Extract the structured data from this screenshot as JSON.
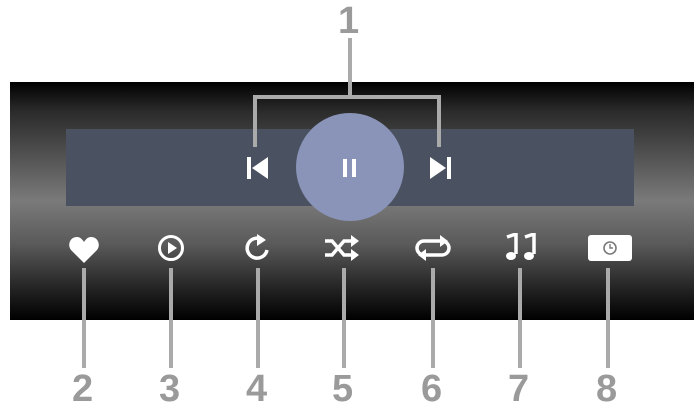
{
  "callouts": [
    "1",
    "2",
    "3",
    "4",
    "5",
    "6",
    "7",
    "8"
  ],
  "colors": {
    "panel_dark": "#000000",
    "panel_mid": "#7a7a7a",
    "transport_bar": "#4a5160",
    "play_circle": "#8a94b8",
    "icon": "#ffffff",
    "callout": "#9a9a9a"
  },
  "controls": {
    "transport": [
      "previous-icon",
      "pause-icon",
      "next-icon"
    ],
    "bottom": [
      "heart-icon",
      "play-circle-icon",
      "rotate-icon",
      "shuffle-icon",
      "repeat-icon",
      "music-notes-icon",
      "slideshow-timer-icon"
    ]
  }
}
